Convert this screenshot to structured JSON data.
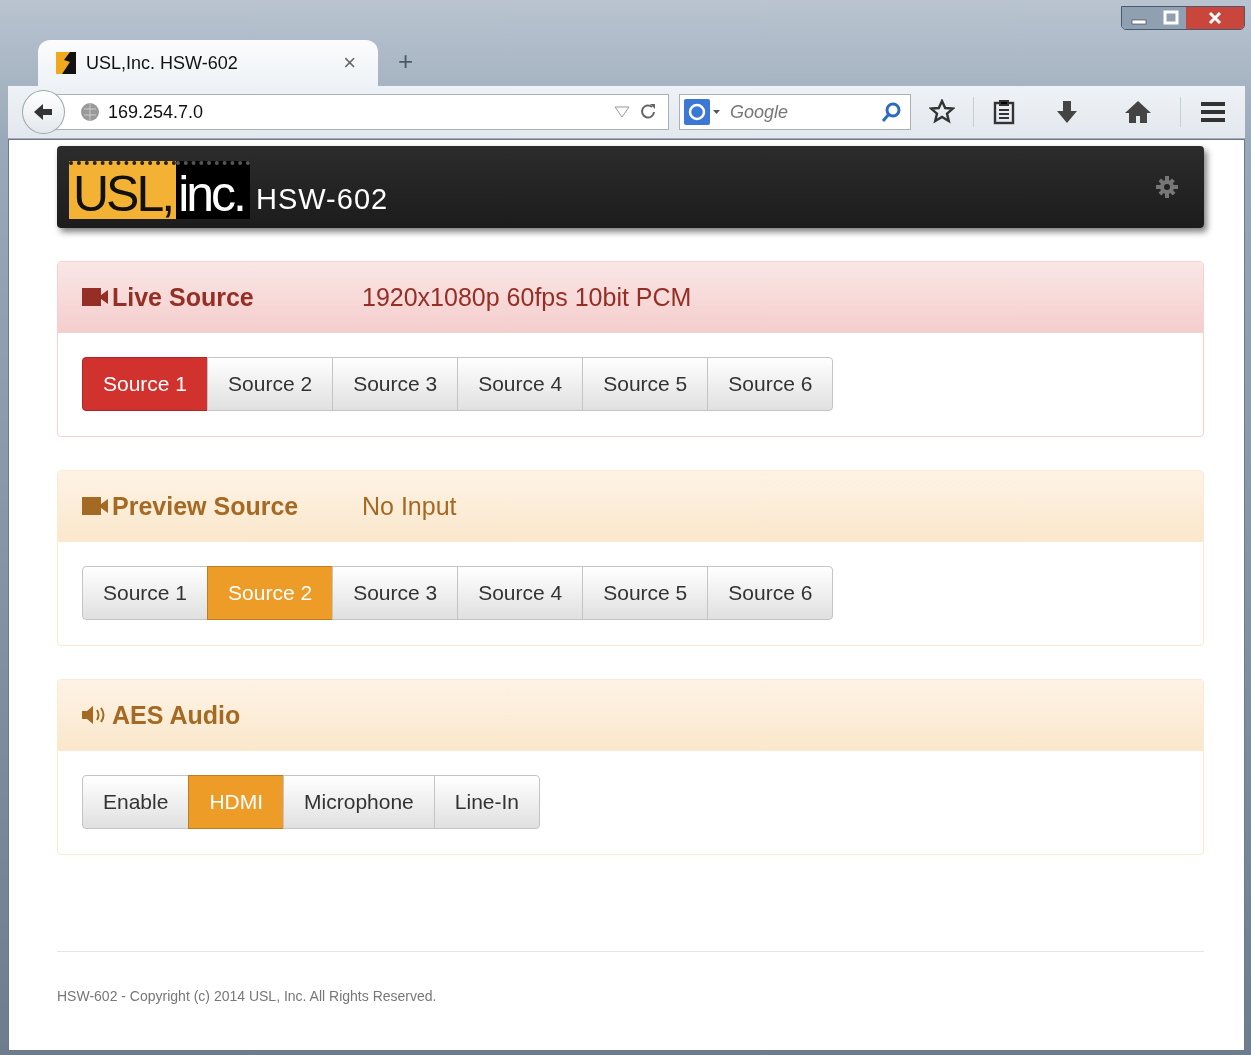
{
  "browser": {
    "tab": {
      "title": "USL,Inc. HSW-602",
      "close": "×"
    },
    "new_tab": "+",
    "address": "169.254.7.0",
    "search": {
      "placeholder": "Google"
    }
  },
  "header": {
    "logo": {
      "left": "USL,",
      "right": "inc."
    },
    "title": "HSW-602"
  },
  "panels": [
    {
      "kind": "video",
      "color": "#d2322d",
      "title": "Live Source",
      "status": "1920x1080p 60fps 10bit PCM",
      "buttons": [
        {
          "label": "Source 1",
          "selected": true
        },
        {
          "label": "Source 2",
          "selected": false
        },
        {
          "label": "Source 3",
          "selected": false
        },
        {
          "label": "Source 4",
          "selected": false
        },
        {
          "label": "Source 5",
          "selected": false
        },
        {
          "label": "Source 6",
          "selected": false
        }
      ]
    },
    {
      "kind": "video",
      "color": "#ed9c28",
      "title": "Preview Source",
      "status": "No Input",
      "buttons": [
        {
          "label": "Source 1",
          "selected": false
        },
        {
          "label": "Source 2",
          "selected": true
        },
        {
          "label": "Source 3",
          "selected": false
        },
        {
          "label": "Source 4",
          "selected": false
        },
        {
          "label": "Source 5",
          "selected": false
        },
        {
          "label": "Source 6",
          "selected": false
        }
      ]
    },
    {
      "kind": "audio",
      "color": "#ed9c28",
      "title": "AES Audio",
      "buttons": [
        {
          "label": "Enable",
          "selected": false
        },
        {
          "label": "HDMI",
          "selected": true
        },
        {
          "label": "Microphone",
          "selected": false
        },
        {
          "label": "Line-In",
          "selected": false
        }
      ]
    }
  ],
  "footer": "HSW-602 - Copyright (c) 2014 USL, Inc. All Rights Reserved."
}
